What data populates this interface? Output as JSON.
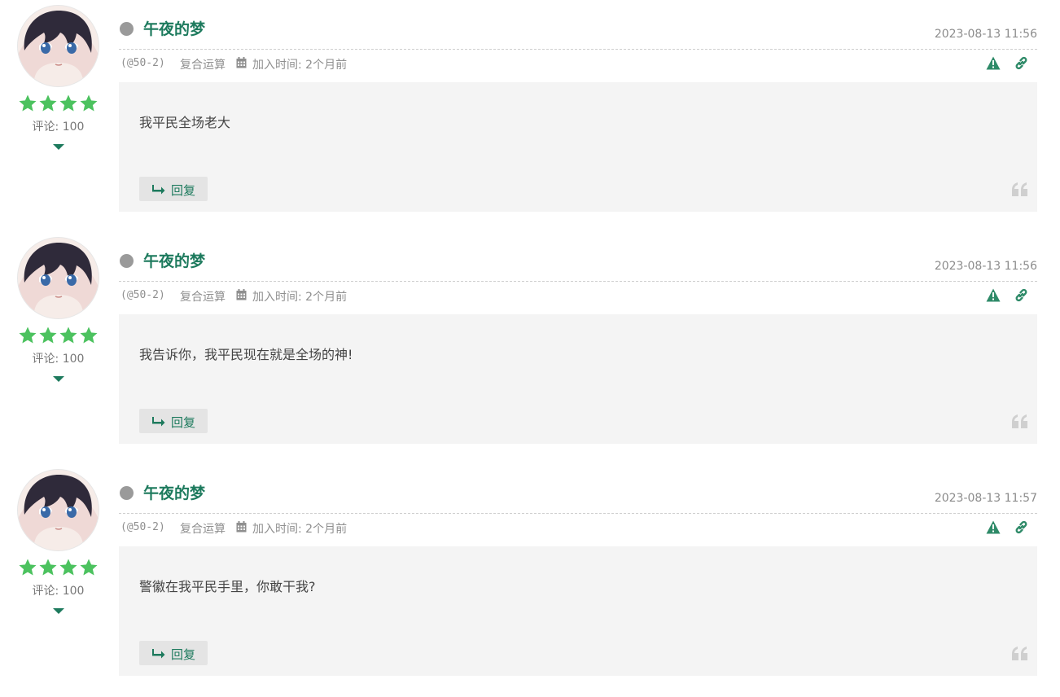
{
  "colors": {
    "accent": "#1d7a5d",
    "star": "#4cc25f",
    "status_dot": "#9a9a9a",
    "panel": "#f4f4f4"
  },
  "comments": [
    {
      "author": "午夜的梦",
      "time": "2023-08-13 11:56",
      "ua": "(@50-2)",
      "address": "复合运算",
      "joined": "加入时间: 2个月前",
      "text": "我平民全场老大",
      "rating_stars": 4,
      "comment_count": "评论: 100",
      "reply_label": "回复"
    },
    {
      "author": "午夜的梦",
      "time": "2023-08-13 11:56",
      "ua": "(@50-2)",
      "address": "复合运算",
      "joined": "加入时间: 2个月前",
      "text": "我告诉你，我平民现在就是全场的神!",
      "rating_stars": 4,
      "comment_count": "评论: 100",
      "reply_label": "回复"
    },
    {
      "author": "午夜的梦",
      "time": "2023-08-13 11:57",
      "ua": "(@50-2)",
      "address": "复合运算",
      "joined": "加入时间: 2个月前",
      "text": "警徽在我平民手里，你敢干我?",
      "rating_stars": 4,
      "comment_count": "评论: 100",
      "reply_label": "回复"
    }
  ],
  "icons": [
    "star-icon",
    "caret-down-icon",
    "calendar-icon",
    "warning-icon",
    "link-icon",
    "reply-arrow-icon",
    "quote-icon"
  ]
}
